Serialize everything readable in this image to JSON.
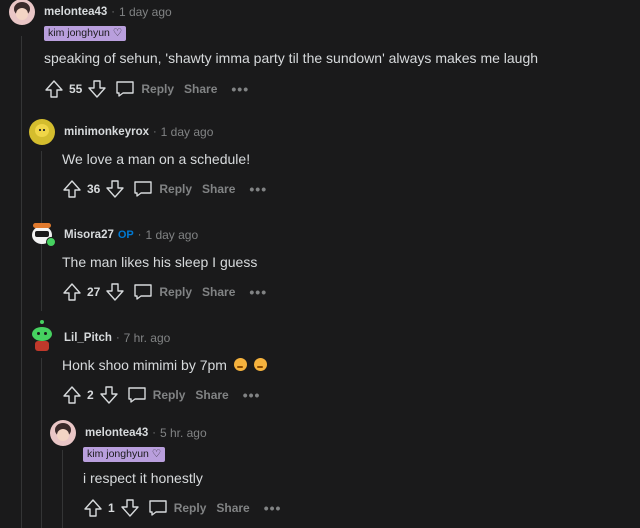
{
  "comments": [
    {
      "author": "melontea43",
      "time": "1 day ago",
      "flair": "kim jonghyun ♡",
      "body": "speaking of sehun, 'shawty imma party til the sundown' always makes me laugh",
      "score": "55"
    },
    {
      "author": "minimonkeyrox",
      "time": "1 day ago",
      "body": "We love a man on a schedule!",
      "score": "36"
    },
    {
      "author": "Misora27",
      "op": "OP",
      "time": "1 day ago",
      "body": "The man likes his sleep I guess",
      "score": "27"
    },
    {
      "author": "Lil_Pitch",
      "time": "7 hr. ago",
      "body": "Honk shoo mimimi by 7pm",
      "score": "2"
    },
    {
      "author": "melontea43",
      "time": "5 hr. ago",
      "flair": "kim jonghyun ♡",
      "body": "i respect it honestly",
      "score": "1"
    }
  ],
  "labels": {
    "reply": "Reply",
    "share": "Share",
    "more": "•••",
    "dot": "·"
  },
  "colors": {
    "background": "#1a1a1b",
    "flair": "#b99fdd",
    "op": "#0079d3",
    "muted": "#818384",
    "text": "#d7dadc"
  },
  "icons": [
    "upvote-icon",
    "downvote-icon",
    "reply-icon",
    "more-icon",
    "sleepy-emoji-icon"
  ]
}
